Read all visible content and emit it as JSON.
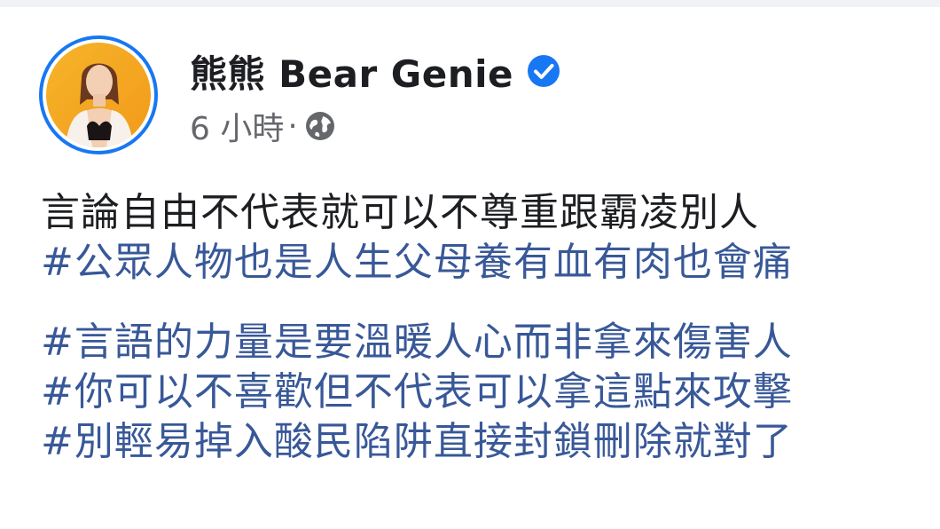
{
  "post": {
    "author": "熊熊 Bear Genie",
    "time": "6 小時",
    "separator": "·",
    "verified_icon": "verified-badge-icon",
    "privacy_icon": "globe-icon",
    "colors": {
      "accent": "#1877f2",
      "hashtag": "#385898",
      "text": "#1c1e21",
      "muted": "#65676b"
    },
    "body": {
      "text": "言論自由不代表就可以不尊重跟霸凌別人",
      "hashtag1": "#公眾人物也是人生父母養有血有肉也會痛",
      "hashtag2": "#言語的力量是要溫暖人心而非拿來傷害人",
      "hashtag3": "#你可以不喜歡但不代表可以拿這點來攻擊",
      "hashtag4": "#別輕易掉入酸民陷阱直接封鎖刪除就對了"
    }
  }
}
